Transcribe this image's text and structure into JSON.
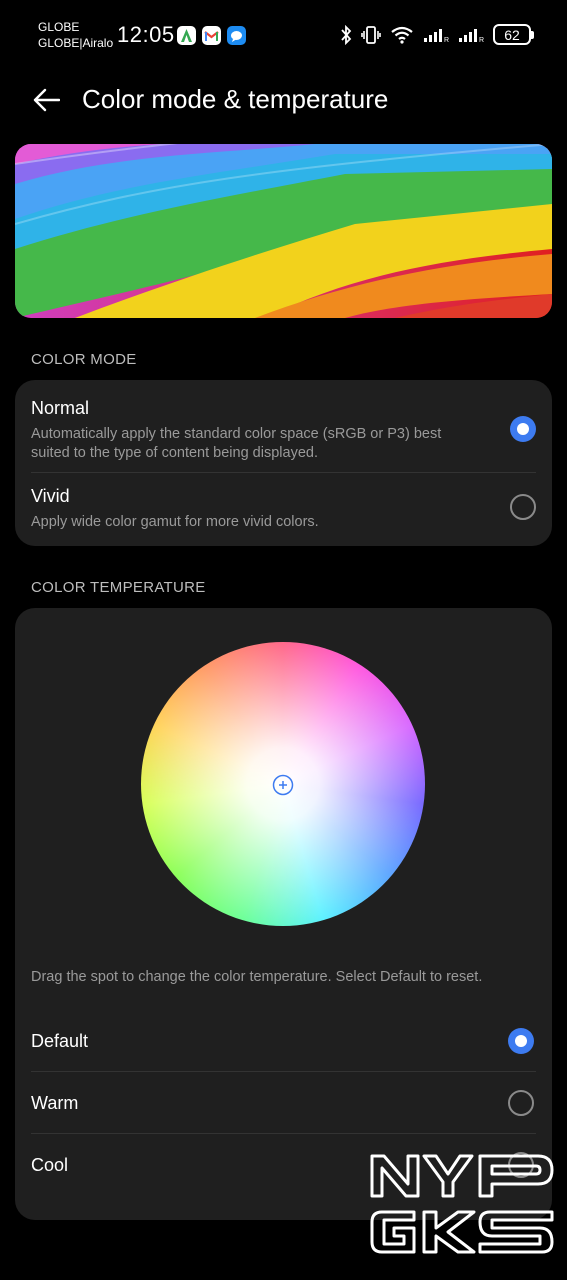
{
  "status_bar": {
    "carrier_line1": "GLOBE",
    "carrier_line2": "GLOBE|Airalo",
    "time": "12:05",
    "battery": "62",
    "app_icons": [
      "android-auto-icon",
      "gmail-icon",
      "messages-icon"
    ],
    "system_icons": [
      "bluetooth-icon",
      "vibrate-icon",
      "wifi-icon",
      "signal-icon",
      "signal-icon"
    ]
  },
  "header": {
    "title": "Color mode & temperature"
  },
  "color_mode": {
    "section_label": "COLOR MODE",
    "options": [
      {
        "title": "Normal",
        "description": "Automatically apply the standard color space (sRGB or P3) best suited to the type of content being displayed.",
        "selected": true
      },
      {
        "title": "Vivid",
        "description": "Apply wide color gamut for more vivid colors.",
        "selected": false
      }
    ]
  },
  "color_temperature": {
    "section_label": "COLOR TEMPERATURE",
    "hint": "Drag the spot to change the color temperature. Select Default to reset.",
    "options": [
      {
        "title": "Default",
        "selected": true
      },
      {
        "title": "Warm",
        "selected": false
      },
      {
        "title": "Cool",
        "selected": false
      }
    ]
  },
  "watermark": {
    "line1": "NYP",
    "line2": "GKS"
  },
  "colors": {
    "accent": "#3d7bf0",
    "card": "#1f1f1f",
    "background": "#000000"
  }
}
